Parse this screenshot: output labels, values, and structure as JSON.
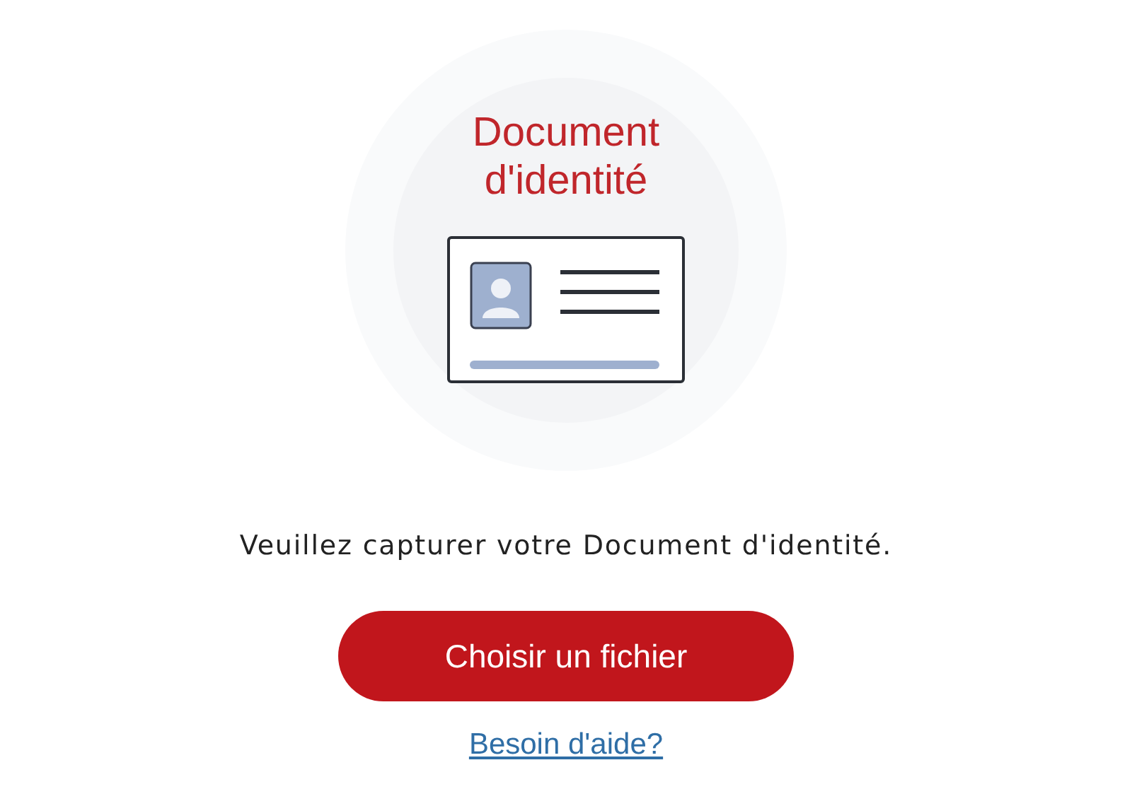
{
  "card_title": "Document d'identité",
  "instruction": "Veuillez capturer votre Document d'identité.",
  "upload_button": "Choisir un fichier",
  "help_link": "Besoin d'aide?"
}
